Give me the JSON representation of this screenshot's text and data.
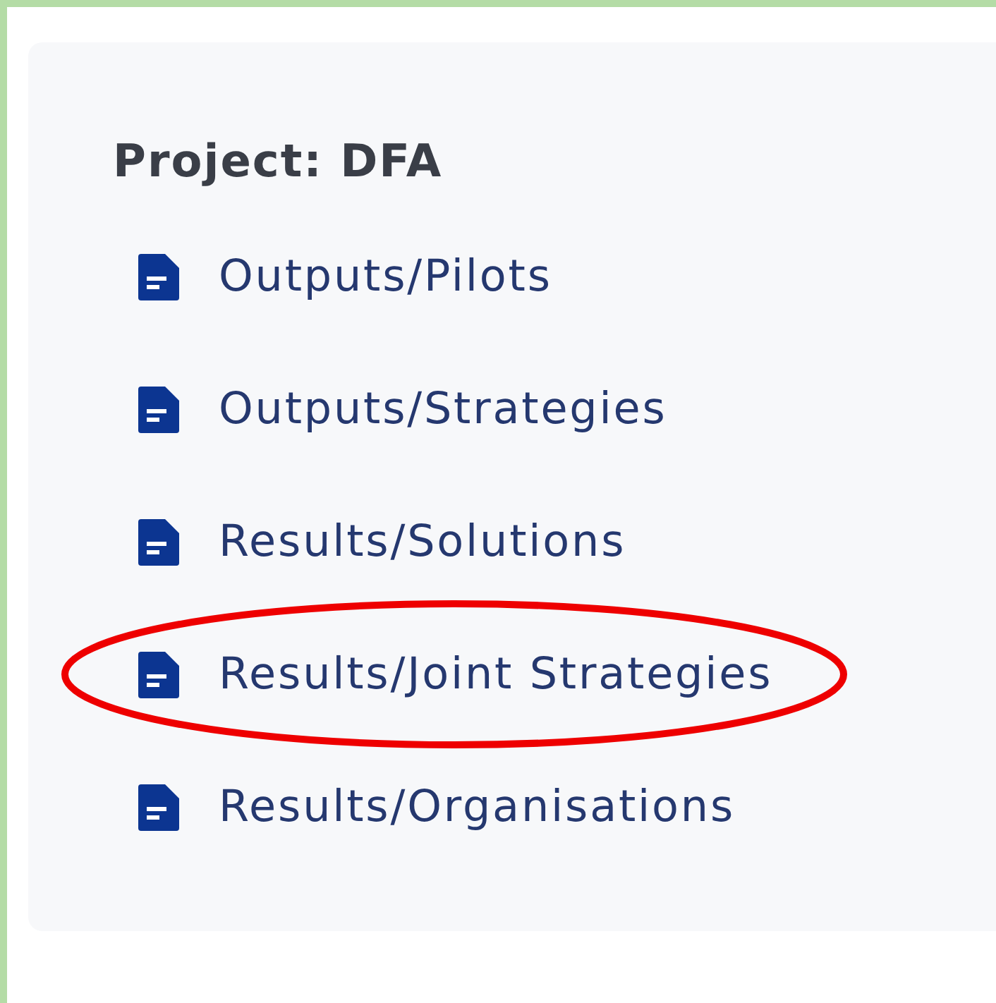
{
  "project": {
    "title": "Project: DFA"
  },
  "items": [
    {
      "label": "Outputs/Pilots",
      "highlighted": false
    },
    {
      "label": "Outputs/Strategies",
      "highlighted": false
    },
    {
      "label": "Results/Solutions",
      "highlighted": false
    },
    {
      "label": "Results/Joint Strategies",
      "highlighted": true
    },
    {
      "label": "Results/Organisations",
      "highlighted": false
    }
  ]
}
